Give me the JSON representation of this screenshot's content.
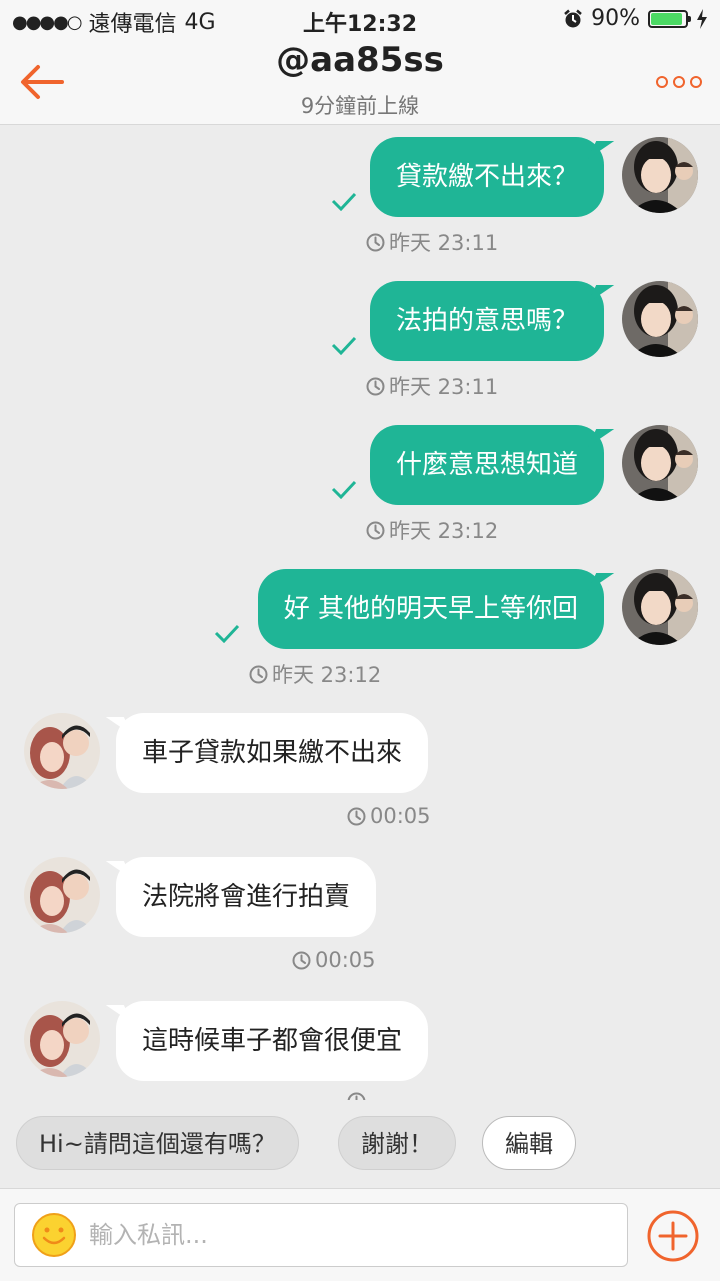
{
  "status_bar": {
    "carrier": "遠傳電信",
    "network": "4G",
    "time": "上午12:32",
    "battery": "90%",
    "battery_level": 0.9
  },
  "header": {
    "title": "@aa85ss",
    "subtitle": "9分鐘前上線"
  },
  "messages": [
    {
      "direction": "outgoing",
      "text": "貸款繳不出來？",
      "time": "昨天 23:11",
      "read": true
    },
    {
      "direction": "outgoing",
      "text": "法拍的意思嗎？",
      "time": "昨天 23:11",
      "read": true
    },
    {
      "direction": "outgoing",
      "text": "什麼意思想知道",
      "time": "昨天 23:12",
      "read": true
    },
    {
      "direction": "outgoing",
      "text": "好 其他的明天早上等你回",
      "time": "昨天 23:12",
      "read": true
    },
    {
      "direction": "incoming",
      "text": "車子貸款如果繳不出來",
      "time": "00:05"
    },
    {
      "direction": "incoming",
      "text": "法院將會進行拍賣",
      "time": "00:05"
    },
    {
      "direction": "incoming",
      "text": "這時候車子都會很便宜",
      "time": ""
    }
  ],
  "quick_replies": [
    "Hi~請問這個還有嗎？",
    "謝謝！",
    "編輯"
  ],
  "input": {
    "placeholder": "輸入私訊..."
  },
  "colors": {
    "accent": "#f0642d",
    "bubble_out": "#1fb596",
    "bubble_in": "#ffffff",
    "background": "#ececec"
  }
}
